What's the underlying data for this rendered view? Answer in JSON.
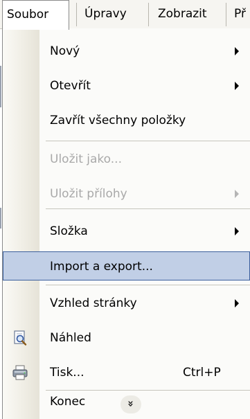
{
  "menubar": {
    "items": [
      {
        "label": "Soubor",
        "active": true
      },
      {
        "label": "Úpravy",
        "active": false
      },
      {
        "label": "Zobrazit",
        "active": false
      },
      {
        "label": "Př",
        "active": false
      }
    ]
  },
  "menu": {
    "items": [
      {
        "label": "Nový",
        "submenu": true,
        "disabled": false
      },
      {
        "label": "Otevřít",
        "submenu": true,
        "disabled": false
      },
      {
        "label": "Zavřít všechny položky",
        "submenu": false,
        "disabled": false
      },
      {
        "label": "Uložit jako...",
        "submenu": false,
        "disabled": true
      },
      {
        "label": "Uložit přílohy",
        "submenu": true,
        "disabled": true
      },
      {
        "label": "Složka",
        "submenu": true,
        "disabled": false
      },
      {
        "label": "Import a export...",
        "submenu": false,
        "disabled": false,
        "highlighted": true
      },
      {
        "label": "Vzhled stránky",
        "submenu": true,
        "disabled": false
      },
      {
        "label": "Náhled",
        "submenu": false,
        "disabled": false,
        "icon": "print-preview-icon"
      },
      {
        "label": "Tisk...",
        "shortcut": "Ctrl+P",
        "submenu": false,
        "disabled": false,
        "icon": "printer-icon"
      },
      {
        "label": "Konec",
        "submenu": false,
        "disabled": false
      }
    ],
    "expand_glyph": "»"
  },
  "colors": {
    "highlight_fill": "#c1cfe6",
    "highlight_border": "#3b5f9d",
    "disabled_text": "#a9a9a9"
  }
}
